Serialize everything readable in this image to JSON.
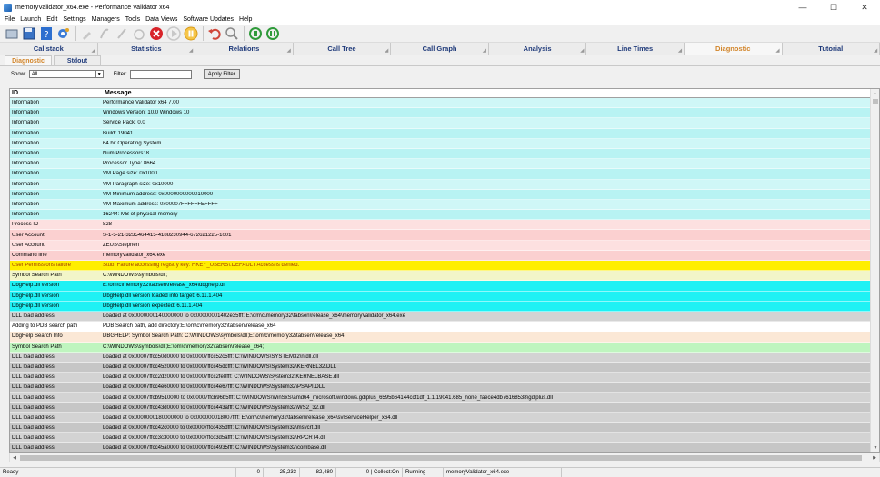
{
  "window": {
    "title": "memoryValidator_x64.exe - Performance Validator x64",
    "min": "—",
    "max": "☐",
    "close": "✕"
  },
  "menu": [
    "File",
    "Launch",
    "Edit",
    "Settings",
    "Managers",
    "Tools",
    "Data Views",
    "Software Updates",
    "Help"
  ],
  "toolbar": {
    "icons": [
      "new-icon",
      "save-icon",
      "help-icon",
      "gear-icon",
      "sep",
      "pin-icon",
      "hook-icon",
      "pen-icon",
      "timer-icon",
      "stop-icon",
      "play-icon",
      "pause-icon",
      "sep",
      "undo-icon",
      "magnify-icon",
      "sep",
      "refresh-icon",
      "refresh-all-icon"
    ]
  },
  "main_tabs": [
    {
      "label": "Callstack",
      "active": false
    },
    {
      "label": "Statistics",
      "active": false
    },
    {
      "label": "Relations",
      "active": false
    },
    {
      "label": "Call Tree",
      "active": false
    },
    {
      "label": "Call Graph",
      "active": false
    },
    {
      "label": "Analysis",
      "active": false
    },
    {
      "label": "Line Times",
      "active": false
    },
    {
      "label": "Diagnostic",
      "active": true
    },
    {
      "label": "Tutorial",
      "active": false
    }
  ],
  "sub_tabs": [
    {
      "label": "Diagnostic",
      "active": true
    },
    {
      "label": "Stdout",
      "active": false
    }
  ],
  "filter": {
    "show_label": "Show:",
    "show_value": "All",
    "filter_label": "Filter:",
    "filter_value": "",
    "apply_label": "Apply Filter"
  },
  "grid": {
    "headers": [
      "ID",
      "Message"
    ],
    "colors": {
      "info": "#cff7f7",
      "info_alt": "#b8f3f3",
      "process": "#fde0e0",
      "process_alt": "#fbd0d0",
      "warning": "#ffee00",
      "search": "#f2f5c8",
      "dbghelp": "#1ff1f4",
      "dll": "#d3d3d3",
      "dll_alt": "#c6c6c6",
      "pdb": "#ffffff",
      "dbghelp_info": "#fbe8d6",
      "green": "#bff5bf"
    },
    "rows": [
      {
        "id": "Information",
        "msg": "Performance Validator x64 7.00",
        "cls": "info"
      },
      {
        "id": "Information",
        "msg": "Windows Version: 10.0 Windows 10",
        "cls": "info_alt"
      },
      {
        "id": "Information",
        "msg": "Service Pack: 0.0",
        "cls": "info"
      },
      {
        "id": "Information",
        "msg": "Build: 19041",
        "cls": "info_alt"
      },
      {
        "id": "Information",
        "msg": "64 bit Operating System",
        "cls": "info"
      },
      {
        "id": "Information",
        "msg": "Num Processors: 8",
        "cls": "info_alt"
      },
      {
        "id": "Information",
        "msg": "Processor Type: 8664",
        "cls": "info"
      },
      {
        "id": "Information",
        "msg": "VM Page size: 0x1000",
        "cls": "info_alt"
      },
      {
        "id": "Information",
        "msg": "VM Paragraph size: 0x10000",
        "cls": "info"
      },
      {
        "id": "Information",
        "msg": "VM Minimum address: 0x0000000000010000",
        "cls": "info_alt"
      },
      {
        "id": "Information",
        "msg": "VM Maximum address: 0x00007FFFFFFEFFFF",
        "cls": "info"
      },
      {
        "id": "Information",
        "msg": "16244: MB of physical memory",
        "cls": "info_alt"
      },
      {
        "id": "Process ID",
        "msg": "828",
        "cls": "process"
      },
      {
        "id": "User Account",
        "msg": "S-1-5-21-3235464415-4188230944-672621225-1001",
        "cls": "process_alt"
      },
      {
        "id": "User Account",
        "msg": "ZEUS\\Stephen",
        "cls": "process"
      },
      {
        "id": "Command line",
        "msg": "memoryValidator_x64.exe\"",
        "cls": "process_alt"
      },
      {
        "id": "User Permissions failure",
        "msg": "Stub: Failure accessing registry key: HKEY_USERS\\.DEFAULT   Access is denied.",
        "cls": "warning"
      },
      {
        "id": "Symbol Search Path",
        "msg": "C:\\WINDOWS\\symbols\\dll;",
        "cls": "search"
      },
      {
        "id": "DbgHelp.dll version",
        "msg": "E:\\om\\c\\memory32\\tabsen\\release_x64\\dbghelp.dll",
        "cls": "dbghelp"
      },
      {
        "id": "DbgHelp.dll version",
        "msg": "DbgHelp.dll version loaded into target: 6.11.1.404",
        "cls": "dbghelp"
      },
      {
        "id": "DbgHelp.dll version",
        "msg": "DbgHelp.dll version expected: 6.11.1.404",
        "cls": "dbghelp"
      },
      {
        "id": "DLL load address",
        "msg": "Loaded at 0x0000000140000000 to 0x00000001402e35fff: E:\\om\\c\\memory32\\tabsen\\release_x64\\memoryValidator_x64.exe",
        "cls": "dll"
      },
      {
        "id": "Adding to PDB search path",
        "msg": "PDB Search path, add directory:E:\\om\\c\\memory32\\tabsen\\release_x64",
        "cls": "pdb"
      },
      {
        "id": "DbgHelp Search Info",
        "msg": "DBGHELP: Symbol Search Path: C:\\WINDOWS\\symbols\\dll;E:\\om\\c\\memory32\\tabsen\\release_x64;",
        "cls": "dbghelp_info"
      },
      {
        "id": "Symbol Search Path",
        "msg": "C:\\WINDOWS\\symbols\\dll;E:\\om\\c\\memory32\\tabsen\\release_x64;",
        "cls": "green"
      },
      {
        "id": "DLL load address",
        "msg": "Loaded at 0x00007ffcc50d0000 to 0x00007ffcc52c5fff: C:\\WINDOWS\\SYSTEM32\\ntdll.dll",
        "cls": "dll"
      },
      {
        "id": "DLL load address",
        "msg": "Loaded at 0x00007ffcc4520000 to 0x00007ffcc45dcfff: C:\\WINDOWS\\System32\\KERNEL32.DLL",
        "cls": "dll_alt"
      },
      {
        "id": "DLL load address",
        "msg": "Loaded at 0x00007ffcc2d20000 to 0x00007ffcc2fe8fff: C:\\WINDOWS\\System32\\KERNELBASE.dll",
        "cls": "dll"
      },
      {
        "id": "DLL load address",
        "msg": "Loaded at 0x00007ffcc4e60000 to 0x00007ffcc4e67fff: C:\\WINDOWS\\System32\\PSAPI.DLL",
        "cls": "dll_alt"
      },
      {
        "id": "DLL load address",
        "msg": "Loaded at 0x00007ffcb9510000 to 0x00007ffcb96b5fff: C:\\WINDOWS\\WinSxS\\amd64_microsoft.windows.gdiplus_6595b64144ccf1df_1.1.19041.685_none_faece4db76168538\\gdiplus.dll",
        "cls": "dll"
      },
      {
        "id": "DLL load address",
        "msg": "Loaded at 0x00007ffcc43d0000 to 0x00007ffcc443afff: C:\\WINDOWS\\System32\\WS2_32.dll",
        "cls": "dll_alt"
      },
      {
        "id": "DLL load address",
        "msg": "Loaded at 0x0000000180000000 to 0x000000018007ffff: E:\\om\\c\\memory32\\tabsen\\release_x64\\svlServiceHelper_x64.dll",
        "cls": "dll"
      },
      {
        "id": "DLL load address",
        "msg": "Loaded at 0x00007ffcc42c0000 to 0x00007ffcc435dfff: C:\\WINDOWS\\System32\\msvcrt.dll",
        "cls": "dll_alt"
      },
      {
        "id": "DLL load address",
        "msg": "Loaded at 0x00007ffcc3c30000 to 0x00007ffcc3d5afff: C:\\WINDOWS\\System32\\RPCRT4.dll",
        "cls": "dll"
      },
      {
        "id": "DLL load address",
        "msg": "Loaded at 0x00007ffcc45a0000 to 0x00007ffcc4935fff: C:\\WINDOWS\\System32\\combase.dll",
        "cls": "dll_alt"
      }
    ]
  },
  "status": {
    "ready": "Ready",
    "c1": "0",
    "c2": "25,233",
    "c3": "82,480",
    "c4": "0 | Collect:On",
    "c5": "Running",
    "c6": "memoryValidator_x64.exe"
  }
}
